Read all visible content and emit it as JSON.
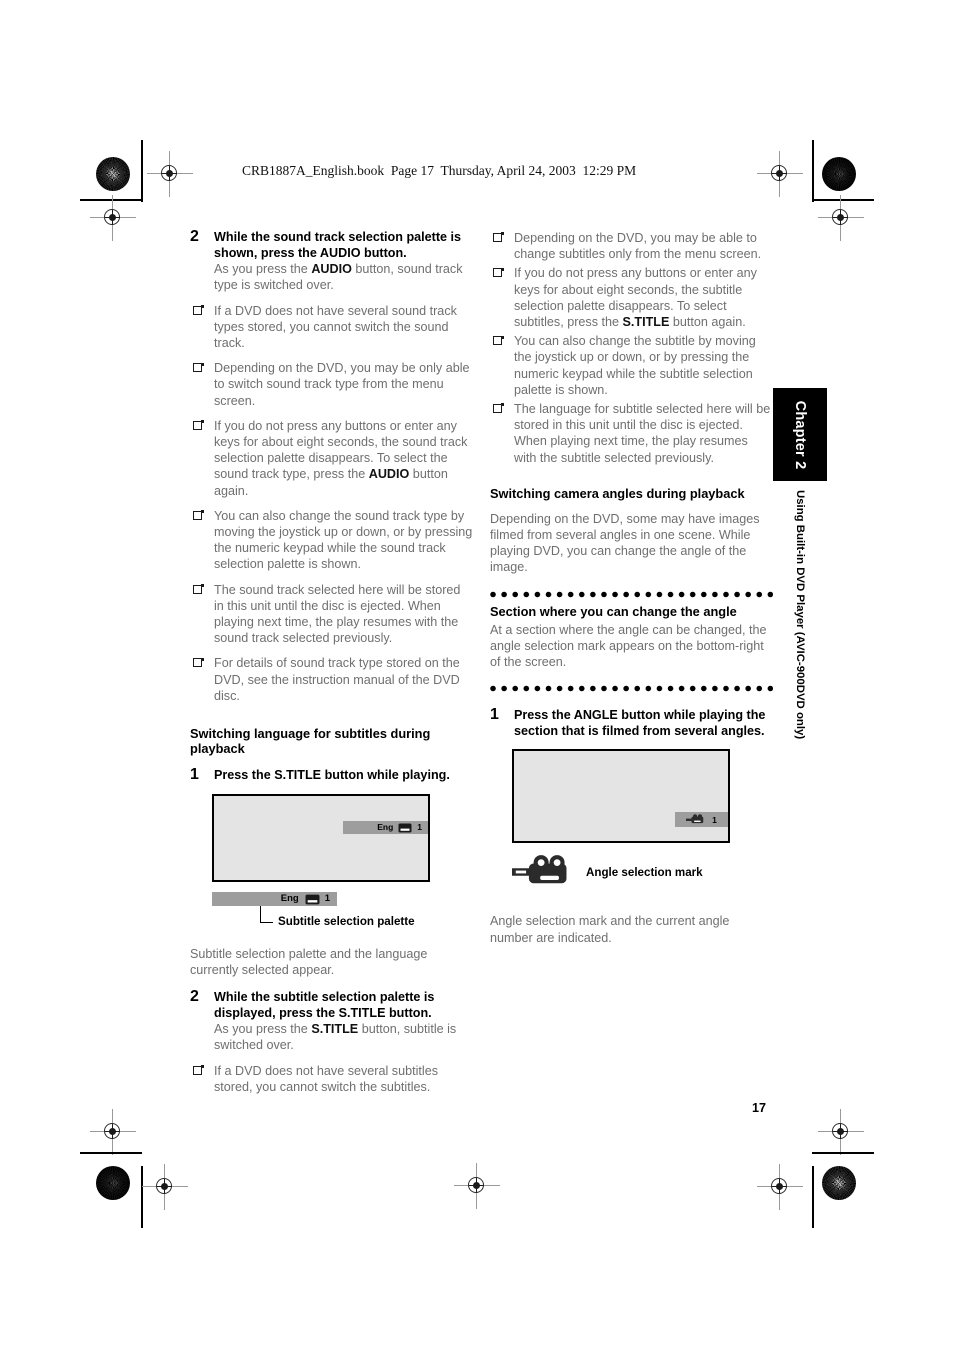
{
  "header": {
    "file_line": "CRB1887A_English.book  Page 17  Thursday, April 24, 2003  12:29 PM"
  },
  "chapter_tab": {
    "label": "Chapter 2",
    "running_head": "Using Built-in DVD Player (AVIC-900DVD only)"
  },
  "page_number": "17",
  "left_column": {
    "step2_audio": {
      "number": "2",
      "title_part1": "While the sound track selection palette is shown, press the ",
      "title_bold": "AUDIO",
      "title_part2": " button.",
      "body_part1": "As you press the ",
      "body_bold": "AUDIO",
      "body_part2": " button, sound track type is switched over."
    },
    "notes": [
      {
        "text": "If a DVD does not have several sound track types stored, you cannot switch the sound track."
      },
      {
        "text": "Depending on the DVD, you may be only able to switch sound track type from the menu screen."
      },
      {
        "pre": "If you do not press any buttons or enter any keys for about eight seconds, the sound track selection palette disappears. To select the sound track type, press the ",
        "bold": "AUDIO",
        "post": " button again."
      },
      {
        "text": "You can also change the sound track type by moving the joystick up or down, or by pressing the numeric keypad while the sound track selection palette is shown."
      },
      {
        "text": "The sound track selected here will be stored in this unit until the disc is ejected. When playing next time, the play resumes with the sound track selected previously."
      },
      {
        "text": "For details of sound track type stored on the DVD, see the instruction manual of the DVD disc."
      }
    ],
    "section_heading": "Switching language for subtitles during playback",
    "step1_stitle": {
      "number": "1",
      "title_part1": "Press the ",
      "title_bold": "S.TITLE",
      "title_part2": " button while playing."
    },
    "screen_osd": {
      "language": "Eng",
      "icon": "subtitle-icon",
      "number": "1"
    },
    "palette_legend": {
      "language": "Eng",
      "icon": "subtitle-icon",
      "number": "1",
      "label": "Subtitle selection palette"
    },
    "caption_after_screen": "Subtitle selection palette and the language currently selected appear.",
    "step2_stitle": {
      "number": "2",
      "title_part1": "While the subtitle selection palette is displayed, press the ",
      "title_bold": "S.TITLE",
      "title_part2": " button.",
      "body_part1": "As you press the ",
      "body_bold": "S.TITLE",
      "body_part2": " button, subtitle is switched over."
    },
    "final_note": {
      "text": "If a DVD does not have several subtitles stored, you cannot switch the subtitles."
    }
  },
  "right_column": {
    "notes": [
      {
        "text": "Depending on the DVD, you may be able to change subtitles only from the menu screen."
      },
      {
        "pre": "If you do not press any buttons or enter any keys for about eight seconds, the subtitle selection palette disappears. To select subtitles, press the ",
        "bold": "S.TITLE",
        "post": " button again."
      },
      {
        "text": "You can also change the subtitle by moving the joystick up or down, or by pressing the numeric keypad while the subtitle selection palette is shown."
      },
      {
        "text": "The language for subtitle selected here will be stored in this unit until the disc is ejected. When playing next time, the play resumes with the subtitle selected previously."
      }
    ],
    "section_heading": "Switching camera angles during playback",
    "section_body": "Depending on the DVD, some may have images filmed from several angles in one scene. While playing DVD, you can change the angle of the image.",
    "sub_heading": "Section where you can change the angle",
    "sub_body": "At a section where the angle can be changed, the angle selection mark appears on the bottom-right of the screen.",
    "step1_angle": {
      "number": "1",
      "title_part1": "Press the ",
      "title_bold": "ANGLE",
      "title_part2": " button while playing the section that is filmed from several angles."
    },
    "screen_osd": {
      "icon": "camera-icon",
      "number": "1"
    },
    "mark_legend": {
      "icon": "camera-icon",
      "label": "Angle selection mark"
    },
    "caption_after_screen": "Angle selection mark and the current angle number are indicated."
  },
  "colors": {
    "screen_fill": "#e4e4e4",
    "osd_bar": "#9d9d9d",
    "body_text": "#6f6f6f",
    "heading_text": "#000000"
  }
}
